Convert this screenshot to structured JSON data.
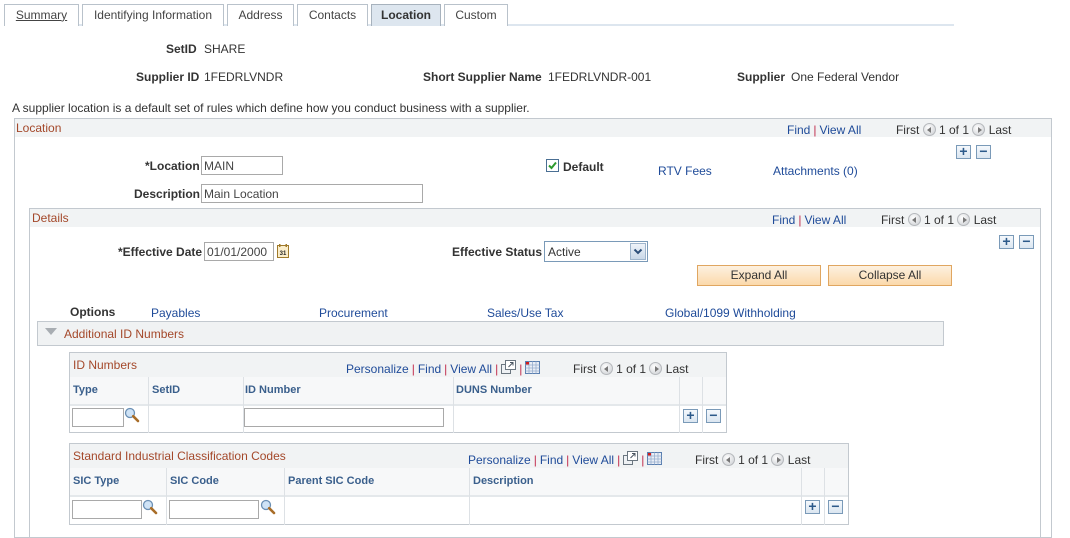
{
  "tabs": [
    {
      "label": "Summary",
      "active": false
    },
    {
      "label": "Identifying Information",
      "active": false
    },
    {
      "label": "Address",
      "active": false
    },
    {
      "label": "Contacts",
      "active": false
    },
    {
      "label": "Location",
      "active": true
    },
    {
      "label": "Custom",
      "active": false
    }
  ],
  "header": {
    "setid_label": "SetID",
    "setid_value": "SHARE",
    "supplier_id_label": "Supplier ID",
    "supplier_id_value": "1FEDRLVNDR",
    "short_name_label": "Short Supplier Name",
    "short_name_value": "1FEDRLVNDR-001",
    "supplier_label": "Supplier",
    "supplier_value": "One Federal Vendor"
  },
  "intro_text": "A supplier location is a default set of rules which define how you conduct business with a supplier.",
  "location_section": {
    "title": "Location",
    "find": "Find",
    "view_all": "View All",
    "first": "First",
    "count": "1 of 1",
    "last": "Last",
    "location_label": "*Location",
    "location_value": "MAIN",
    "description_label": "Description",
    "description_value": "Main Location",
    "default_label": "Default",
    "default_checked": true,
    "rtv_fees": "RTV Fees",
    "attachments": "Attachments (0)",
    "add": "+",
    "remove": "−"
  },
  "details_section": {
    "title": "Details",
    "find": "Find",
    "view_all": "View All",
    "first": "First",
    "count": "1 of 1",
    "last": "Last",
    "effective_date_label": "*Effective Date",
    "effective_date_value": "01/01/2000",
    "effective_status_label": "Effective Status",
    "effective_status_value": "Active",
    "expand_all": "Expand All",
    "collapse_all": "Collapse All",
    "options_label": "Options",
    "options": [
      "Payables",
      "Procurement",
      "Sales/Use Tax",
      "Global/1099 Withholding"
    ],
    "add": "+",
    "remove": "−"
  },
  "additional_id": {
    "title": "Additional ID Numbers"
  },
  "id_numbers_grid": {
    "title": "ID Numbers",
    "personalize": "Personalize",
    "find": "Find",
    "view_all": "View All",
    "first": "First",
    "count": "1 of 1",
    "last": "Last",
    "columns": [
      "Type",
      "SetID",
      "ID Number",
      "DUNS Number"
    ],
    "row": {
      "type": "",
      "setid": "",
      "id_number": "",
      "duns": ""
    },
    "add": "+",
    "remove": "−"
  },
  "sic_grid": {
    "title": "Standard Industrial Classification Codes",
    "personalize": "Personalize",
    "find": "Find",
    "view_all": "View All",
    "first": "First",
    "count": "1 of 1",
    "last": "Last",
    "columns": [
      "SIC Type",
      "SIC Code",
      "Parent SIC Code",
      "Description"
    ],
    "row": {
      "sic_type": "",
      "sic_code": "",
      "parent": "",
      "description": ""
    },
    "add": "+",
    "remove": "−"
  },
  "icons": {
    "lookup": "magnifier-icon",
    "calendar": "calendar-icon",
    "zoom_grid": "new-window-icon",
    "download": "spreadsheet-icon"
  }
}
